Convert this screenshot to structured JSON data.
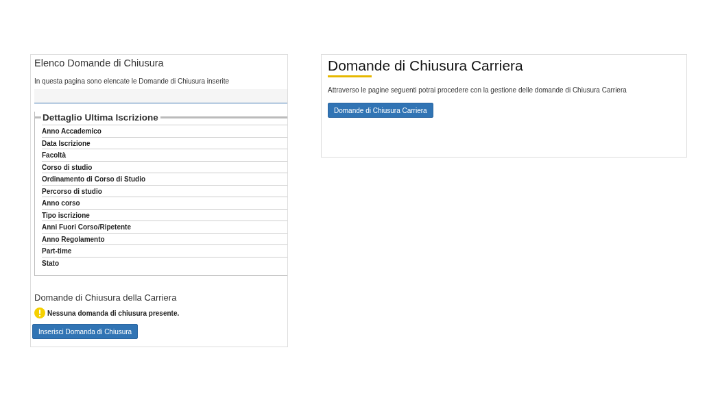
{
  "left_panel": {
    "title": "Elenco Domande di Chiusura",
    "description": "In questa pagina sono elencate le Domande di Chiusura inserite",
    "detail": {
      "legend": "Dettaglio Ultima Iscrizione",
      "rows": [
        "Anno Accademico",
        "Data Iscrizione",
        "Facoltà",
        "Corso di studio",
        "Ordinamento di Corso di Studio",
        "Percorso di studio",
        "Anno corso",
        "Tipo iscrizione",
        "Anni Fuori Corso/Ripetente",
        "Anno Regolamento",
        "Part-time",
        "Stato"
      ]
    },
    "section_title": "Domande di Chiusura della Carriera",
    "warning": "Nessuna domanda di chiusura presente.",
    "button": "Inserisci Domanda di Chiusura"
  },
  "right_panel": {
    "title": "Domande di Chiusura Carriera",
    "description": "Attraverso le pagine seguenti potrai procedere con la gestione delle domande di Chiusura Carriera",
    "button": "Domande di Chiusura Carriera"
  }
}
